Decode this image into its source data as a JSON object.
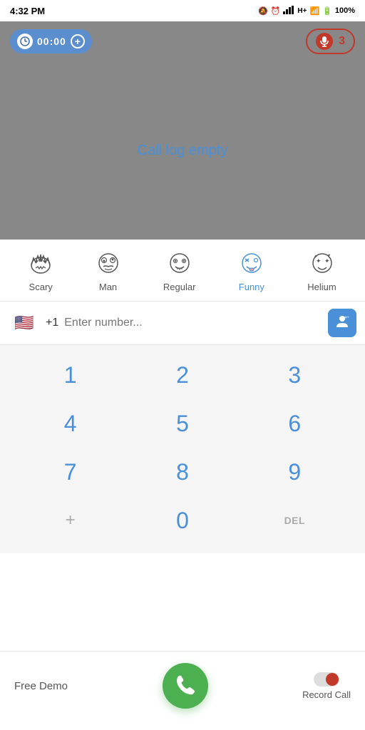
{
  "statusBar": {
    "time": "4:32 PM",
    "battery": "100%"
  },
  "topControls": {
    "timerDisplay": "00:00",
    "recordCount": "3"
  },
  "callLog": {
    "emptyText": "Call log empty"
  },
  "voiceFilters": [
    {
      "id": "scary",
      "label": "Scary",
      "emoji": "😈",
      "active": false
    },
    {
      "id": "man",
      "label": "Man",
      "emoji": "😐",
      "active": false
    },
    {
      "id": "regular",
      "label": "Regular",
      "emoji": "😊",
      "active": false
    },
    {
      "id": "funny",
      "label": "Funny",
      "emoji": "🤪",
      "active": true
    },
    {
      "id": "helium",
      "label": "Helium",
      "emoji": "😵",
      "active": false
    }
  ],
  "phoneInput": {
    "countryCode": "+1",
    "placeholder": "Enter number...",
    "flag": "🇺🇸"
  },
  "dialPad": {
    "rows": [
      [
        "1",
        "2",
        "3"
      ],
      [
        "4",
        "5",
        "6"
      ],
      [
        "7",
        "8",
        "9"
      ],
      [
        "+",
        "0",
        "DEL"
      ]
    ]
  },
  "bottomBar": {
    "freeDemoLabel": "Free Demo",
    "recordCallLabel": "Record Call"
  }
}
